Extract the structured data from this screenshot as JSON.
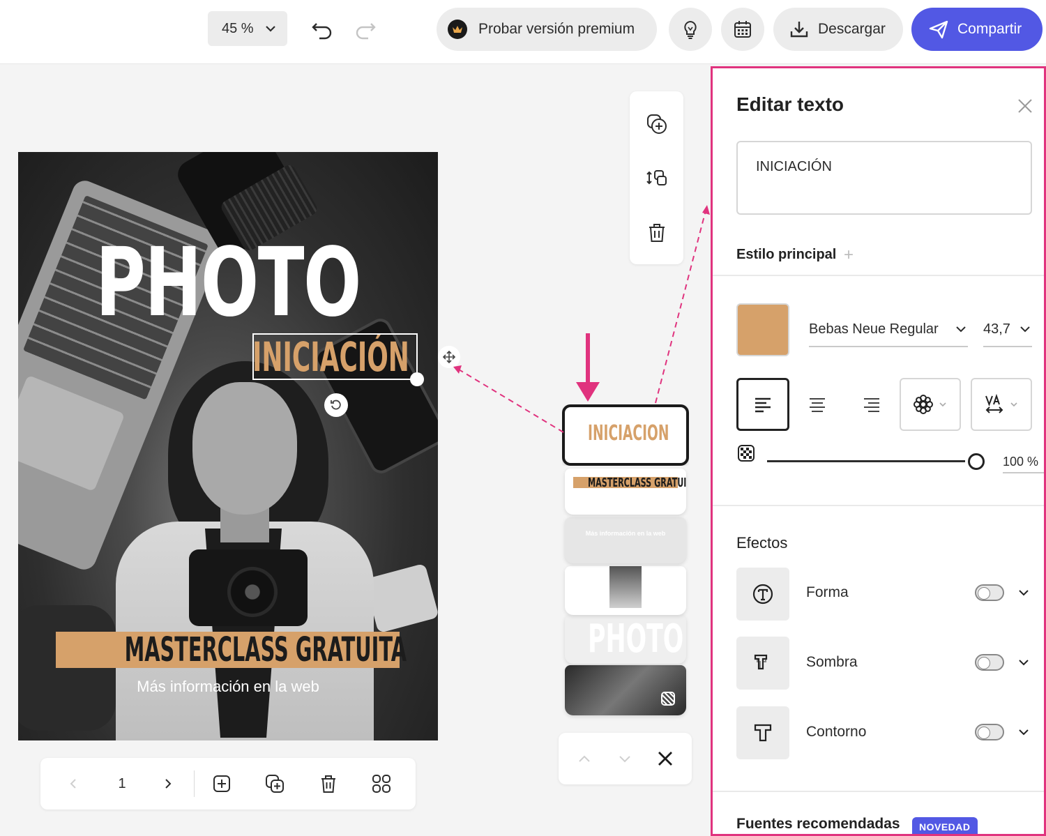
{
  "toolbar": {
    "zoom": "45 %",
    "premium_label": "Probar versión premium",
    "download_label": "Descargar",
    "share_label": "Compartir"
  },
  "poster": {
    "title": "PHOTO",
    "subtitle": "INICIACIÓN",
    "banner": "MASTERCLASS GRATUITA",
    "info": "Más información en la web"
  },
  "layers": {
    "active": "INICIACION",
    "banner": "MASTERCLASS GRATUITA",
    "info": "Más información en la web",
    "title": "PHOTO"
  },
  "page_nav": {
    "page": "1"
  },
  "panel": {
    "title": "Editar texto",
    "text_value": "INICIACIÓN",
    "style_label": "Estilo principal",
    "color": "#d6a16a",
    "font": "Bebas Neue Regular",
    "size": "43,7",
    "opacity": "100 %",
    "opacity_fraction": 1.0,
    "effects_label": "Efectos",
    "effects": [
      {
        "label": "Forma",
        "enabled": false
      },
      {
        "label": "Sombra",
        "enabled": false
      },
      {
        "label": "Contorno",
        "enabled": false
      }
    ],
    "recommended_label": "Fuentes recomendadas",
    "badge": "NOVEDAD"
  },
  "colors": {
    "accent": "#5258e4",
    "highlight": "#e0337e",
    "brand_tan": "#d6a16a"
  }
}
